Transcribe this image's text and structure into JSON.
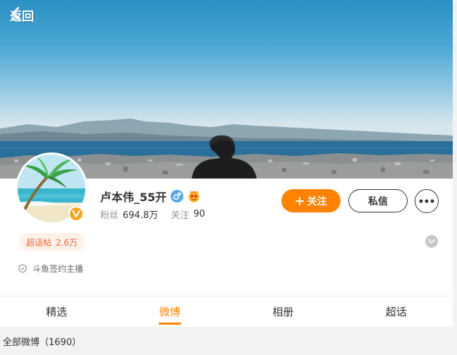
{
  "header": {
    "back_label": "返回"
  },
  "profile": {
    "name": "卢本伟_55开",
    "stats": [
      {
        "label": "粉丝",
        "value": "694.8万"
      },
      {
        "label": "关注",
        "value": "90"
      }
    ],
    "follow_label": "关注",
    "message_label": "私信",
    "super_topic_label": "超话帖",
    "super_topic_count": "2.6万",
    "sign_text": "斗鱼签约主播"
  },
  "tabs": [
    {
      "label": "精选",
      "active": false
    },
    {
      "label": "微博",
      "active": true
    },
    {
      "label": "相册",
      "active": false
    },
    {
      "label": "超话",
      "active": false
    }
  ],
  "feed": {
    "all_posts_label": "全部微博（1690）"
  },
  "colors": {
    "accent": "#ff8200",
    "verified_badge": "#f5a623",
    "topic_pill_text": "#ee6a3c",
    "gender_male": "#5aa7e6"
  }
}
